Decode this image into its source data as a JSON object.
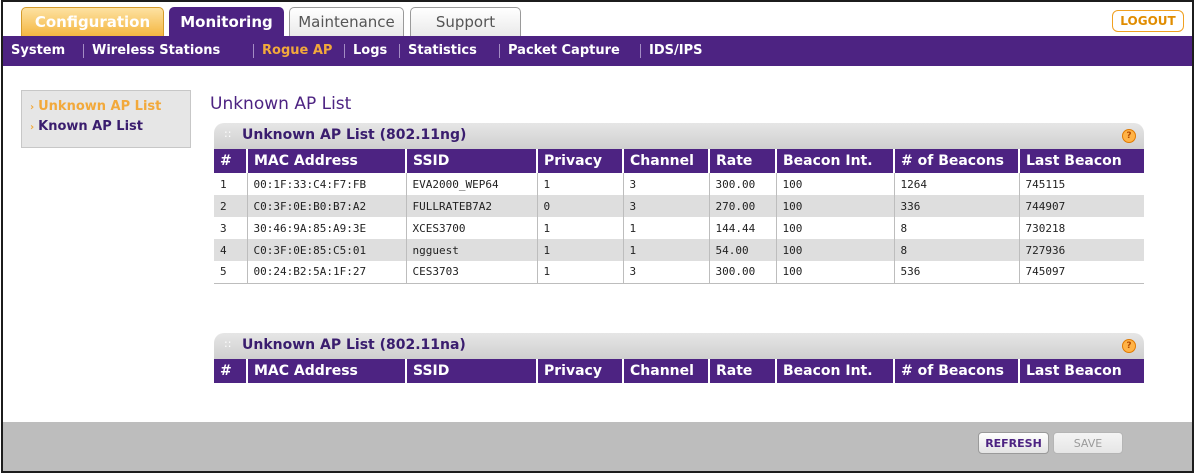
{
  "tabs": [
    {
      "label": "Configuration",
      "active": false
    },
    {
      "label": "Monitoring",
      "active": true
    },
    {
      "label": "Maintenance",
      "active": false
    },
    {
      "label": "Support",
      "active": false
    }
  ],
  "logout_label": "LOGOUT",
  "subnav": [
    "System",
    "Wireless Stations",
    "Rogue AP",
    "Logs",
    "Statistics",
    "Packet Capture",
    "IDS/IPS"
  ],
  "subnav_active": "Rogue AP",
  "leftnav": [
    "Unknown AP List",
    "Known AP List"
  ],
  "page_title": "Unknown AP List",
  "columns": [
    "#",
    "MAC Address",
    "SSID",
    "Privacy",
    "Channel",
    "Rate",
    "Beacon Int.",
    "# of Beacons",
    "Last Beacon"
  ],
  "sections": [
    {
      "title": "Unknown AP List (802.11ng)",
      "rows": [
        [
          "1",
          "00:1F:33:C4:F7:FB",
          "EVA2000_WEP64",
          "1",
          "3",
          "300.00",
          "100",
          "1264",
          "745115"
        ],
        [
          "2",
          "C0:3F:0E:B0:B7:A2",
          "FULLRATEB7A2",
          "0",
          "3",
          "270.00",
          "100",
          "336",
          "744907"
        ],
        [
          "3",
          "30:46:9A:85:A9:3E",
          "XCES3700",
          "1",
          "1",
          "144.44",
          "100",
          "8",
          "730218"
        ],
        [
          "4",
          "C0:3F:0E:85:C5:01",
          "ngguest",
          "1",
          "1",
          "54.00",
          "100",
          "8",
          "727936"
        ],
        [
          "5",
          "00:24:B2:5A:1F:27",
          "CES3703",
          "1",
          "3",
          "300.00",
          "100",
          "536",
          "745097"
        ]
      ]
    },
    {
      "title": "Unknown AP List (802.11na)",
      "rows": []
    }
  ],
  "buttons": {
    "refresh": "REFRESH",
    "save": "SAVE"
  },
  "colors": {
    "brand_purple": "#4d2382",
    "accent_orange": "#f2a93b"
  }
}
